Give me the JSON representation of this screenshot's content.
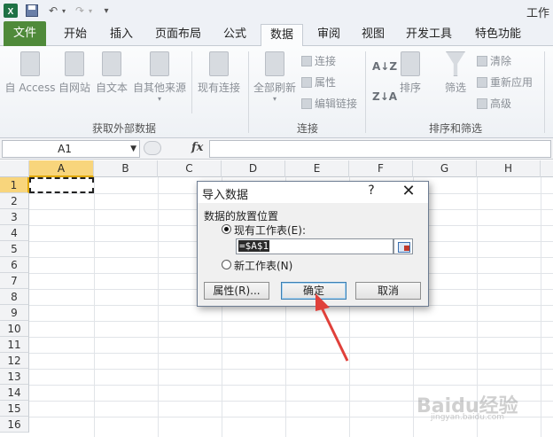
{
  "window": {
    "title": "工作"
  },
  "quick_access": {
    "icons": [
      "excel-logo-icon",
      "save-icon",
      "undo-icon",
      "redo-icon",
      "customize-icon"
    ]
  },
  "tabs": [
    {
      "label": "文件"
    },
    {
      "label": "开始"
    },
    {
      "label": "插入"
    },
    {
      "label": "页面布局"
    },
    {
      "label": "公式"
    },
    {
      "label": "数据"
    },
    {
      "label": "审阅"
    },
    {
      "label": "视图"
    },
    {
      "label": "开发工具"
    },
    {
      "label": "特色功能"
    }
  ],
  "active_tab": "数据",
  "ribbon": {
    "get_external": {
      "label": "获取外部数据",
      "buttons": [
        "自 Access",
        "自网站",
        "自文本",
        "自其他来源",
        "现有连接"
      ]
    },
    "connections": {
      "label": "连接",
      "refresh_all": "全部刷新",
      "items": [
        "连接",
        "属性",
        "编辑链接"
      ]
    },
    "sort_filter": {
      "label": "排序和筛选",
      "sort": "排序",
      "filter": "筛选",
      "items": [
        "清除",
        "重新应用",
        "高级"
      ]
    }
  },
  "formula_bar": {
    "name_box": "A1",
    "fx": "fx",
    "formula": ""
  },
  "grid": {
    "columns": [
      "A",
      "B",
      "C",
      "D",
      "E",
      "F",
      "G",
      "H"
    ],
    "rows": [
      "1",
      "2",
      "3",
      "4",
      "5",
      "6",
      "7",
      "8",
      "9",
      "10",
      "11",
      "12",
      "13",
      "14",
      "15",
      "16"
    ],
    "selected_cell": "A1"
  },
  "dialog": {
    "title": "导入数据",
    "help": "?",
    "close": "✕",
    "section_label": "数据的放置位置",
    "option_existing": "现有工作表(E):",
    "option_new": "新工作表(N)",
    "selected_option": "existing",
    "reference": "=$A$1",
    "buttons": {
      "properties": "属性(R)...",
      "ok": "确定",
      "cancel": "取消"
    }
  },
  "watermark": {
    "text": "Baidu经验",
    "sub": "jingyan.baidu.com"
  },
  "colors": {
    "file_tab": "#4f8a3a",
    "selection": "#f8d57c",
    "arrow": "#e0403a",
    "dialog_border": "#6d7c92"
  }
}
